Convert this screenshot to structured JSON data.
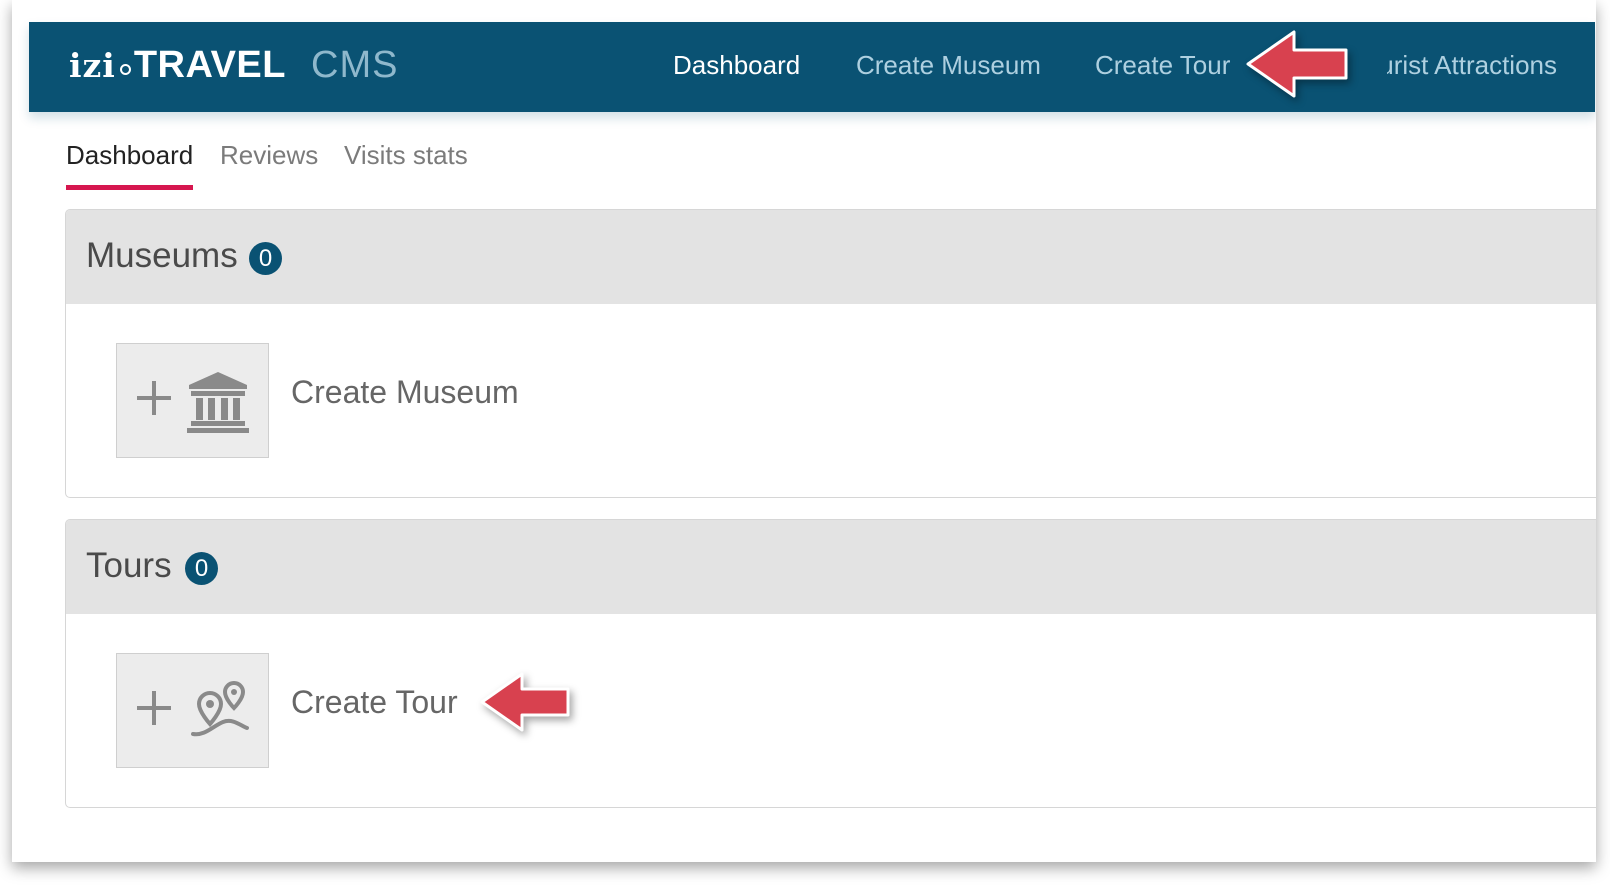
{
  "header": {
    "logo_izi": "izi",
    "logo_travel": "TRAVEL",
    "logo_cms": "CMS",
    "nav": [
      {
        "label": "Dashboard"
      },
      {
        "label": "Create Museum"
      },
      {
        "label": "Create Tour"
      },
      {
        "label": "Tourist Attractions"
      }
    ]
  },
  "tabs": [
    {
      "label": "Dashboard"
    },
    {
      "label": "Reviews"
    },
    {
      "label": "Visits stats"
    }
  ],
  "museums": {
    "title": "Museums",
    "count": "0",
    "create_label": "Create Museum",
    "icon": "museum-icon"
  },
  "tours": {
    "title": "Tours",
    "count": "0",
    "create_label": "Create Tour",
    "icon": "map-pin-route-icon"
  },
  "colors": {
    "header_bg": "#0a5273",
    "active_tab_underline": "#d6164f",
    "annotation_arrow": "#d8414f",
    "badge_bg": "#0a5273"
  }
}
